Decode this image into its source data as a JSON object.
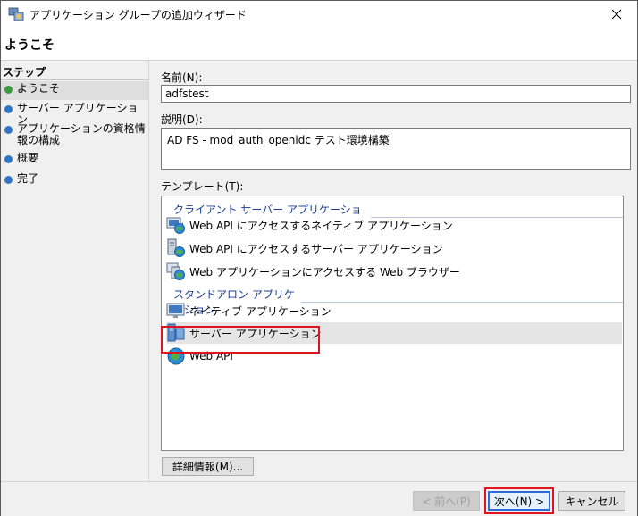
{
  "window": {
    "title": "アプリケーション グループの追加ウィザード"
  },
  "header": {
    "title": "ようこそ"
  },
  "steps": {
    "heading": "ステップ",
    "items": [
      {
        "label": "ようこそ",
        "state": "current",
        "color": "#3c9a3c"
      },
      {
        "label": "サーバー アプリケーション",
        "state": "pending",
        "color": "#2f74c7"
      },
      {
        "label": "アプリケーションの資格情報の構成",
        "state": "pending",
        "color": "#2f74c7"
      },
      {
        "label": "概要",
        "state": "pending",
        "color": "#2f74c7"
      },
      {
        "label": "完了",
        "state": "pending",
        "color": "#2f74c7"
      }
    ]
  },
  "form": {
    "name_label": "名前(N):",
    "name_value": "adfstest",
    "desc_label": "説明(D):",
    "desc_value": "AD FS - mod_auth_openidc テスト環境構築",
    "template_label": "テンプレート(T):"
  },
  "templates": {
    "client_group": "クライアント サーバー アプリケーション",
    "client_items": [
      {
        "label": "Web API にアクセスするネイティブ アプリケーション",
        "icon": "native-webapi-icon"
      },
      {
        "label": "Web API にアクセスするサーバー アプリケーション",
        "icon": "server-webapi-icon"
      },
      {
        "label": "Web アプリケーションにアクセスする Web ブラウザー",
        "icon": "browser-webapp-icon"
      }
    ],
    "standalone_group": "スタンドアロン アプリケーション",
    "standalone_items": [
      {
        "label": "ネイティブ アプリケーション",
        "icon": "native-app-icon"
      },
      {
        "label": "サーバー アプリケーション",
        "icon": "server-app-icon",
        "selected": true
      },
      {
        "label": "Web API",
        "icon": "globe-icon"
      }
    ]
  },
  "buttons": {
    "details": "詳細情報(M)...",
    "prev": "< 前へ(P)",
    "next": "次へ(N) >",
    "cancel": "キャンセル"
  },
  "colors": {
    "highlight_red": "#e0141e",
    "group_blue": "#1c3f95",
    "accent_blue": "#2f6bd4"
  }
}
